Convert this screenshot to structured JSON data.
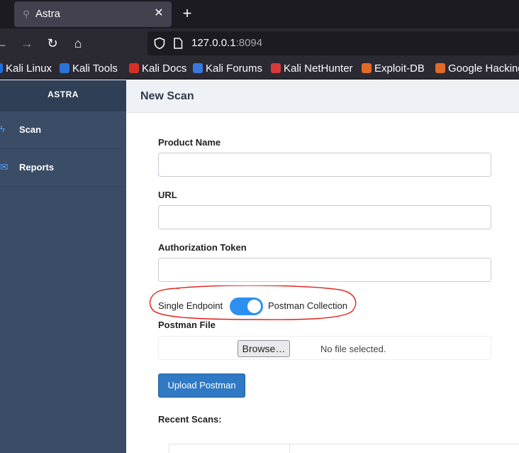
{
  "browser": {
    "tab_title": "Astra",
    "tab_close": "✕",
    "new_tab": "+",
    "url_host": "127.0.0.1",
    "url_port": ":8094",
    "nav": {
      "back": "←",
      "forward": "→",
      "reload": "↻",
      "home": "⌂"
    },
    "bookmarks": [
      {
        "label": "Kali Linux",
        "color": "#1d6ee0"
      },
      {
        "label": "Kali Tools",
        "color": "#2b74d8"
      },
      {
        "label": "Kali Docs",
        "color": "#d93025"
      },
      {
        "label": "Kali Forums",
        "color": "#3a78e0"
      },
      {
        "label": "Kali NetHunter",
        "color": "#d63b3b"
      },
      {
        "label": "Exploit-DB",
        "color": "#e06a28"
      },
      {
        "label": "Google Hacking",
        "color": "#e06a28"
      }
    ]
  },
  "sidebar": {
    "brand": "ASTRA",
    "items": [
      {
        "label": "Scan",
        "icon": "bolt-icon",
        "glyph": "ϟ"
      },
      {
        "label": "Reports",
        "icon": "envelope-icon",
        "glyph": "✉"
      }
    ]
  },
  "main": {
    "title": "New Scan",
    "product_name_label": "Product Name",
    "product_name_value": "",
    "url_label": "URL",
    "url_value": "",
    "auth_label": "Authorization Token",
    "auth_value": "",
    "toggle_left": "Single Endpoint",
    "toggle_right": "Postman Collection",
    "toggle_on": true,
    "postman_file_label": "Postman File",
    "browse_label": "Browse…",
    "no_file": "No file selected.",
    "upload_label": "Upload Postman",
    "recent_label": "Recent Scans:"
  },
  "colors": {
    "accent": "#2d8ff0",
    "sidebar": "#3a4c66",
    "upload_button": "#3079c4",
    "annotation": "#e0201a"
  }
}
